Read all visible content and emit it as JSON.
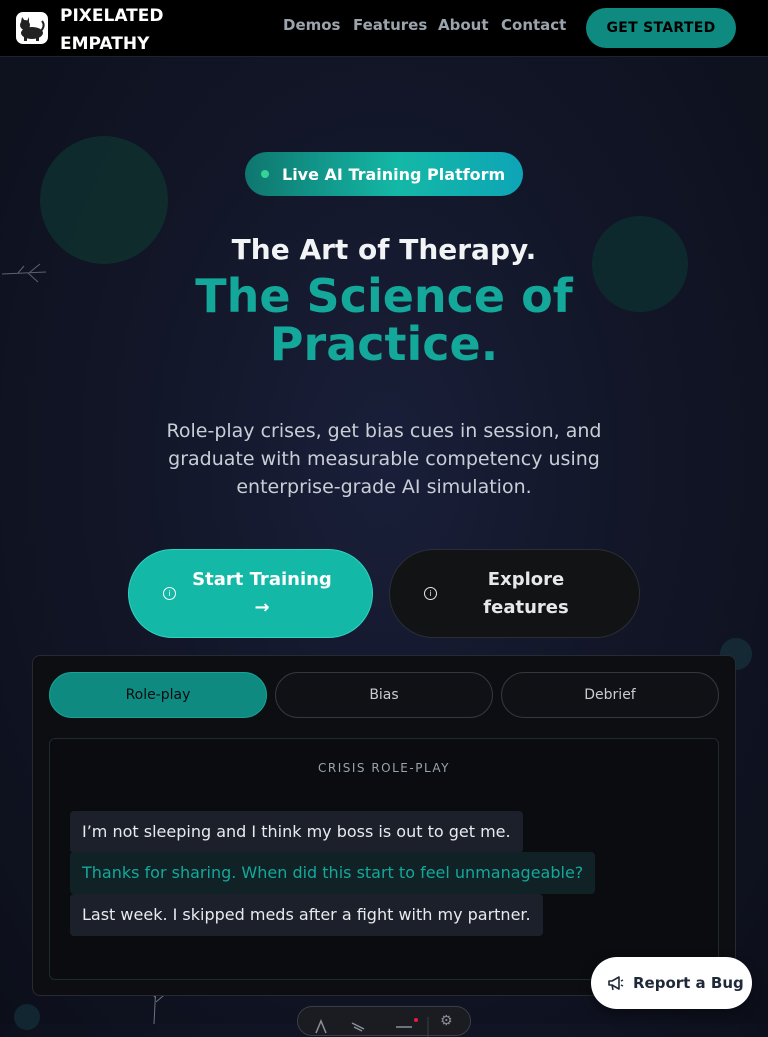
{
  "header": {
    "brand": "PIXELATED EMPATHY",
    "nav": [
      "Demos",
      "Features",
      "About",
      "Contact"
    ],
    "cta": "GET STARTED"
  },
  "hero": {
    "badge": "Live AI Training Platform",
    "headline_line1": "The Art of Therapy.",
    "headline_line2": "The Science of Practice.",
    "subtitle": "Role-play crises, get bias cues in session, and graduate with measurable competency using enterprise-grade AI simulation.",
    "primary_button": "Start Training →",
    "secondary_button": "Explore features"
  },
  "demo": {
    "tabs": [
      "Role-play",
      "Bias",
      "Debrief"
    ],
    "active_tab": "Role-play",
    "card_title": "CRISIS ROLE-PLAY",
    "messages": [
      {
        "role": "user",
        "text": "I’m not sleeping and I think my boss is out to get me."
      },
      {
        "role": "ai",
        "text": "Thanks for sharing. When did this start to feel unmanageable?"
      },
      {
        "role": "user",
        "text": "Last week. I skipped meds after a fight with my partner."
      }
    ]
  },
  "report_bug": "Report a Bug",
  "icons": {
    "logo": "cat-logo-icon",
    "button_info": "info-circle-icon",
    "bug": "megaphone-icon"
  },
  "colors": {
    "accent": "#14b8a6",
    "accent_dark": "#0f8a80",
    "background": "#121628"
  }
}
